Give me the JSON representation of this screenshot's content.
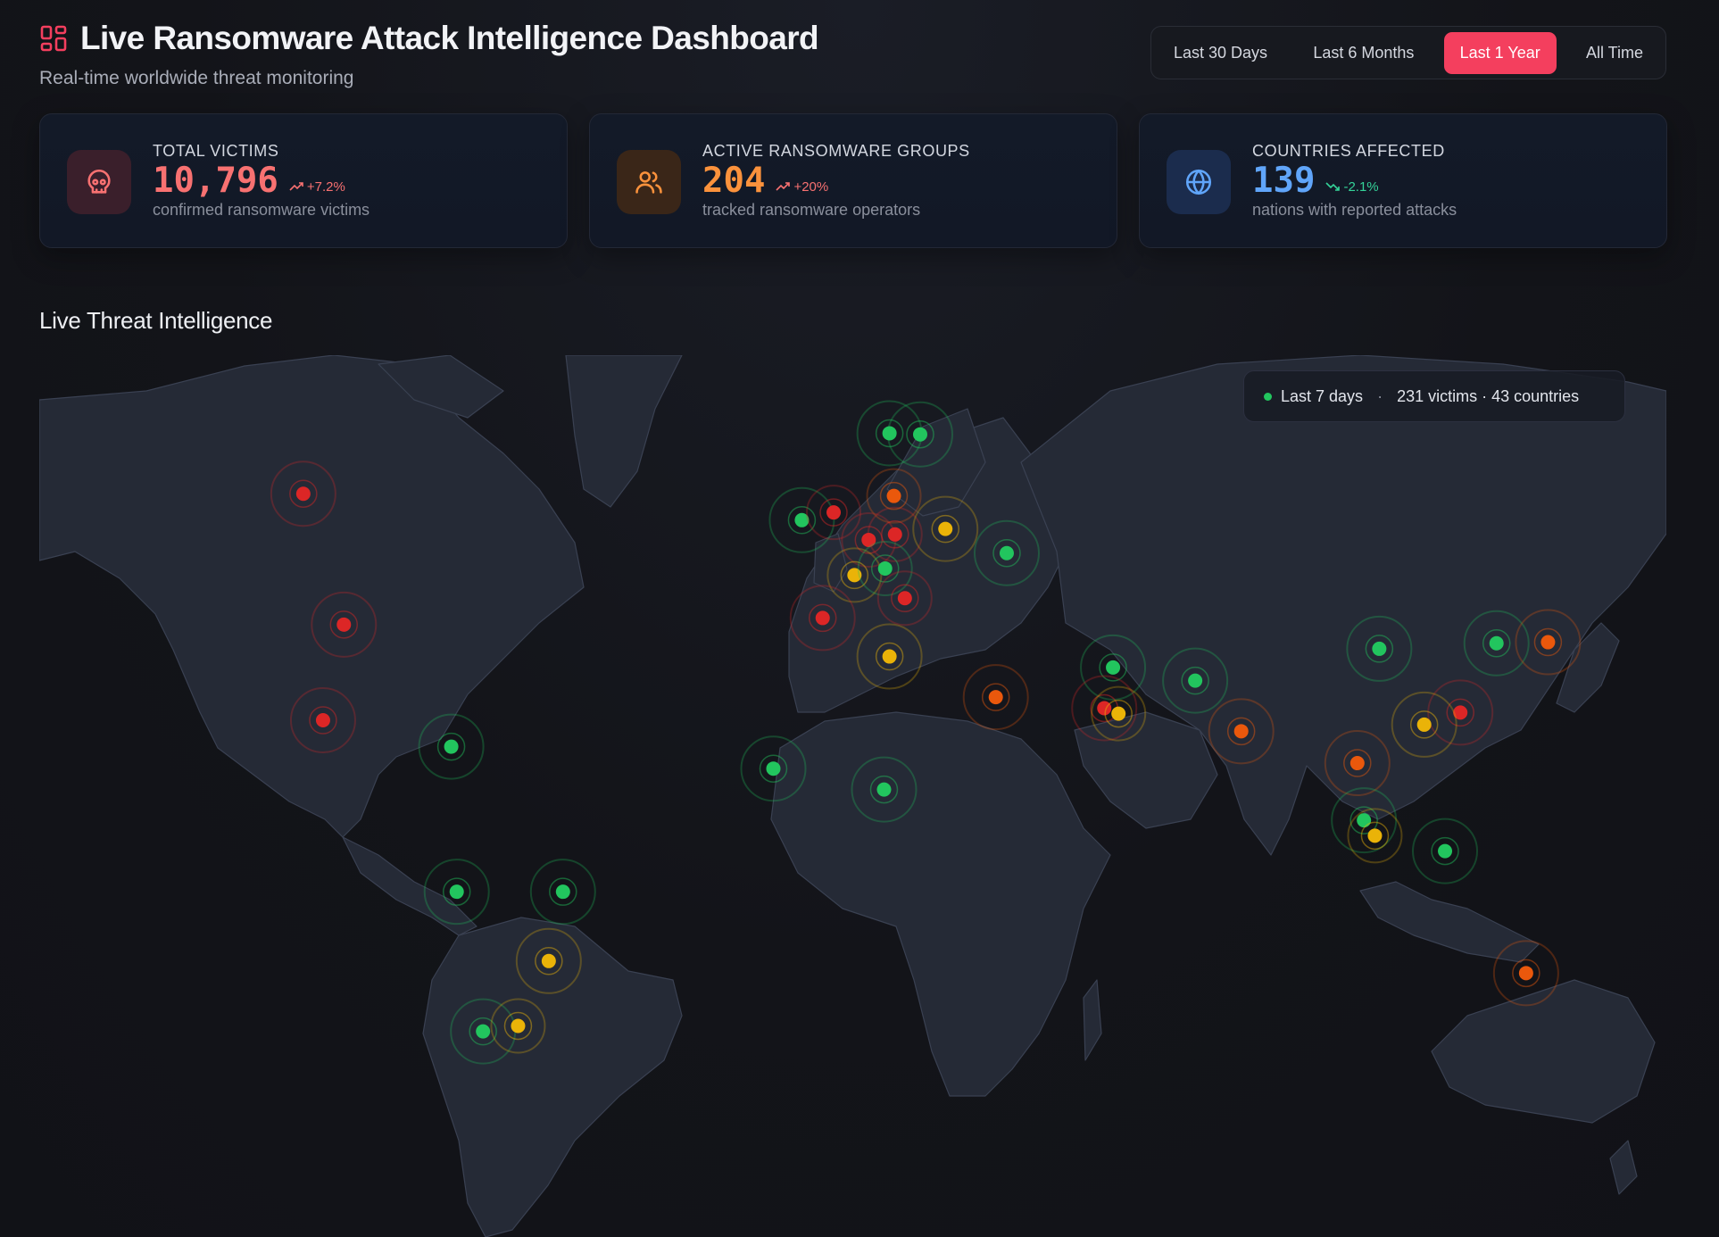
{
  "header": {
    "title": "Live Ransomware Attack Intelligence Dashboard",
    "subtitle": "Real-time worldwide threat monitoring"
  },
  "time_range": {
    "options": [
      "Last 30 Days",
      "Last 6 Months",
      "Last 1 Year",
      "All Time"
    ],
    "selected": "Last 1 Year"
  },
  "stats": [
    {
      "label": "TOTAL VICTIMS",
      "value": "10,796",
      "trend": "+7.2%",
      "trend_direction": "up",
      "description": "confirmed ransomware victims",
      "icon": "skull-icon",
      "color": "#f87171"
    },
    {
      "label": "ACTIVE RANSOMWARE GROUPS",
      "value": "204",
      "trend": "+20%",
      "trend_direction": "up",
      "description": "tracked ransomware operators",
      "icon": "users-icon",
      "color": "#fb923c"
    },
    {
      "label": "COUNTRIES AFFECTED",
      "value": "139",
      "trend": "-2.1%",
      "trend_direction": "down",
      "description": "nations with reported attacks",
      "icon": "globe-icon",
      "color": "#60a5fa"
    }
  ],
  "map": {
    "section_title": "Live Threat Intelligence",
    "badge": {
      "period": "Last 7 days",
      "separator": "·",
      "summary": "231 victims · 43 countries"
    },
    "severity_colors": {
      "critical": "#dc2626",
      "high": "#ea580c",
      "medium": "#eab308",
      "low": "#22c55e"
    },
    "colors": {
      "land": "#252a36",
      "land_stroke": "#3a4152",
      "ocean": "#14161c"
    }
  }
}
